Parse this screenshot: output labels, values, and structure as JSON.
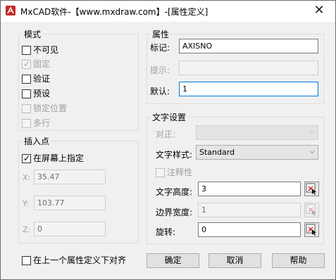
{
  "window": {
    "title": "MxCAD软件-【www.mxdraw.com】-[属性定义]",
    "close_glyph": "✕"
  },
  "mode": {
    "legend": "模式",
    "options": [
      {
        "label": "不可见",
        "checked": false,
        "enabled": true
      },
      {
        "label": "固定",
        "checked": true,
        "enabled": false
      },
      {
        "label": "验证",
        "checked": false,
        "enabled": true
      },
      {
        "label": "预设",
        "checked": false,
        "enabled": true
      },
      {
        "label": "锁定位置",
        "checked": false,
        "enabled": false
      },
      {
        "label": "多行",
        "checked": false,
        "enabled": false
      }
    ]
  },
  "insert_point": {
    "legend": "插入点",
    "on_screen": {
      "label": "在屏幕上指定",
      "checked": true
    },
    "x": {
      "label": "X:",
      "value": "35.47"
    },
    "y": {
      "label": "Y:",
      "value": "103.77"
    },
    "z": {
      "label": "Z:",
      "value": "0"
    }
  },
  "attribute": {
    "legend": "属性",
    "tag": {
      "label": "标记:",
      "value": "AXISNO"
    },
    "prompt": {
      "label": "提示:",
      "value": ""
    },
    "default": {
      "label": "默认:",
      "value": "1"
    }
  },
  "text_settings": {
    "legend": "文字设置",
    "justify": {
      "label": "对正:",
      "value": ""
    },
    "style": {
      "label": "文字样式:",
      "value": "Standard"
    },
    "annotative": {
      "label": "注释性",
      "checked": false
    },
    "height": {
      "label": "文字高度:",
      "value": "3"
    },
    "boundary_width": {
      "label": "边界宽度:",
      "value": "1"
    },
    "rotation": {
      "label": "旋转:",
      "value": "0"
    }
  },
  "align_below": {
    "label": "在上一个属性定义下对齐",
    "checked": false
  },
  "buttons": {
    "ok": "确定",
    "cancel": "取消",
    "help": "帮助"
  },
  "icons": {
    "app": "mxcad-app-icon",
    "pick": "pick-point-icon",
    "dropdown": "chevron-down-icon"
  },
  "colors": {
    "focus": "#0078d7",
    "pick_red": "#cc1111"
  }
}
